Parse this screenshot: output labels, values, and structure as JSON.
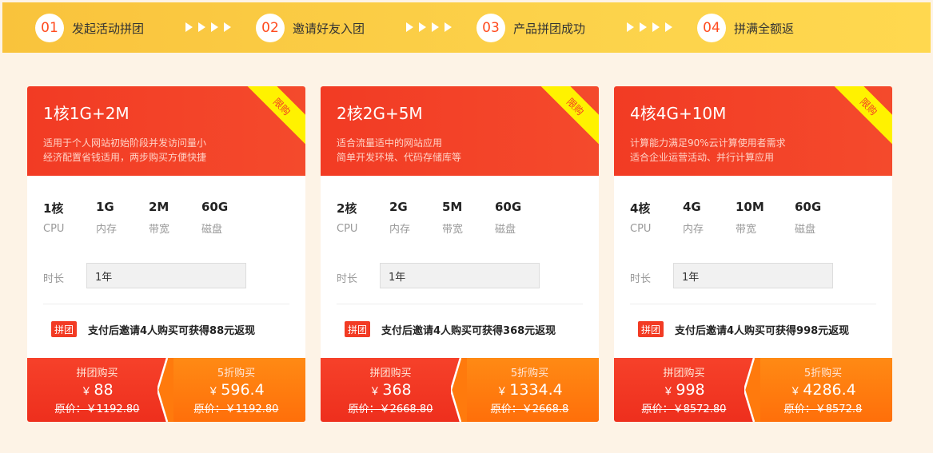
{
  "steps": [
    {
      "num": "01",
      "text": "发起活动拼团"
    },
    {
      "num": "02",
      "text": "邀请好友入团"
    },
    {
      "num": "03",
      "text": "产品拼团成功"
    },
    {
      "num": "04",
      "text": "拼满全额返"
    }
  ],
  "colors": {
    "accent": "#f23b24",
    "orange": "#ff7a0d",
    "yellow": "#fcd24a"
  },
  "cards": [
    {
      "title": "1核1G+2M",
      "ribbon": "限购",
      "desc1": "适用于个人网站初始阶段并发访问量小",
      "desc2": "经济配置省钱适用，两步购买方便快捷",
      "specs": [
        {
          "value": "1核",
          "label": "CPU"
        },
        {
          "value": "1G",
          "label": "内存"
        },
        {
          "value": "2M",
          "label": "带宽"
        },
        {
          "value": "60G",
          "label": "磁盘"
        }
      ],
      "duration_label": "时长",
      "duration_value": "1年",
      "group_tag": "拼团",
      "group_text": "支付后邀请4人购买可获得88元返现",
      "buy_group": {
        "label": "拼团购买",
        "yen": "￥",
        "price": "88",
        "orig": "原价：￥1192.80"
      },
      "buy_half": {
        "label": "5折购买",
        "yen": "￥",
        "price": "596.4",
        "orig": "原价：￥1192.80"
      }
    },
    {
      "title": "2核2G+5M",
      "ribbon": "限购",
      "desc1": "适合流量适中的网站应用",
      "desc2": "简单开发环境、代码存储库等",
      "specs": [
        {
          "value": "2核",
          "label": "CPU"
        },
        {
          "value": "2G",
          "label": "内存"
        },
        {
          "value": "5M",
          "label": "带宽"
        },
        {
          "value": "60G",
          "label": "磁盘"
        }
      ],
      "duration_label": "时长",
      "duration_value": "1年",
      "group_tag": "拼团",
      "group_text": "支付后邀请4人购买可获得368元返现",
      "buy_group": {
        "label": "拼团购买",
        "yen": "￥",
        "price": "368",
        "orig": "原价：￥2668.80"
      },
      "buy_half": {
        "label": "5折购买",
        "yen": "￥",
        "price": "1334.4",
        "orig": "原价：￥2668.8"
      }
    },
    {
      "title": "4核4G+10M",
      "ribbon": "限购",
      "desc1": "计算能力满足90%云计算使用者需求",
      "desc2": "适合企业运营活动、并行计算应用",
      "specs": [
        {
          "value": "4核",
          "label": "CPU"
        },
        {
          "value": "4G",
          "label": "内存"
        },
        {
          "value": "10M",
          "label": "带宽"
        },
        {
          "value": "60G",
          "label": "磁盘"
        }
      ],
      "duration_label": "时长",
      "duration_value": "1年",
      "group_tag": "拼团",
      "group_text": "支付后邀请4人购买可获得998元返现",
      "buy_group": {
        "label": "拼团购买",
        "yen": "￥",
        "price": "998",
        "orig": "原价：￥8572.80"
      },
      "buy_half": {
        "label": "5折购买",
        "yen": "￥",
        "price": "4286.4",
        "orig": "原价：￥8572.8"
      }
    }
  ]
}
